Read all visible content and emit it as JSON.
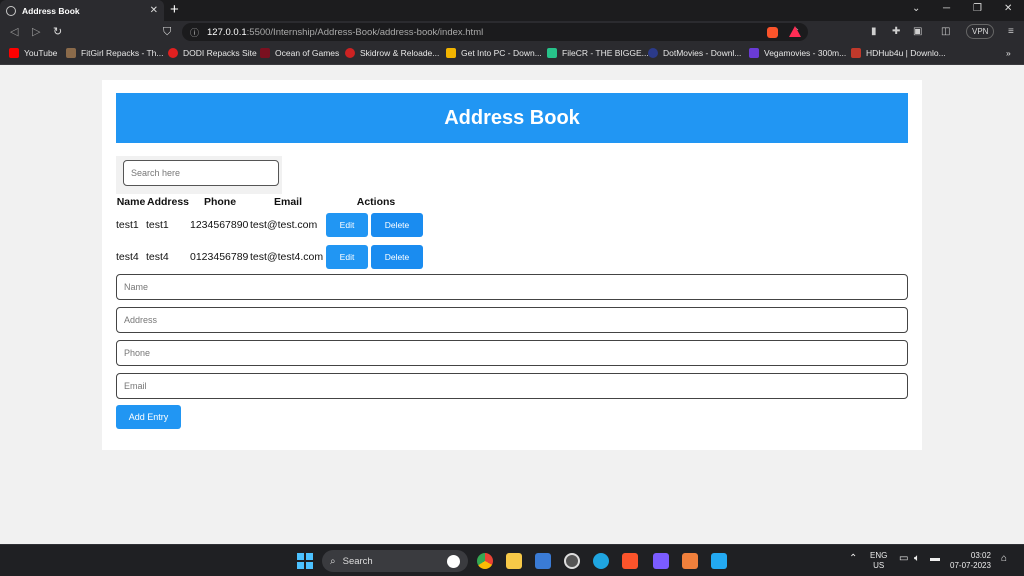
{
  "browser": {
    "tab_title": "Address Book",
    "tab_close": "✕",
    "new_tab": "+",
    "url_host": "127.0.0.1",
    "url_path": ":5500/Internship/Address-Book/address-book/index.html",
    "vpn_label": "VPN",
    "bookmarks": [
      {
        "label": "YouTube",
        "color": "#ff0000"
      },
      {
        "label": "FitGirl Repacks - Th...",
        "color": "#8a6a4a"
      },
      {
        "label": "DODI Repacks Site",
        "color": "#e02020"
      },
      {
        "label": "Ocean of Games",
        "color": "#7a1020"
      },
      {
        "label": "Skidrow & Reloade...",
        "color": "#cc2222"
      },
      {
        "label": "Get Into PC - Down...",
        "color": "#f2b400"
      },
      {
        "label": "FileCR - THE BIGGE...",
        "color": "#27c28a"
      },
      {
        "label": "DotMovies - Downl...",
        "color": "#2b3a8a"
      },
      {
        "label": "Vegamovies - 300m...",
        "color": "#6a3bd6"
      },
      {
        "label": "HDHub4u | Downlo...",
        "color": "#c0392b"
      }
    ],
    "bookmarks_more": "»"
  },
  "page": {
    "title": "Address Book",
    "search_placeholder": "Search here",
    "columns": [
      "Name",
      "Address",
      "Phone",
      "Email",
      "Actions"
    ],
    "entries": [
      {
        "name": "test1",
        "address": "test1",
        "phone": "1234567890",
        "email": "test@test.com"
      },
      {
        "name": "test4",
        "address": "test4",
        "phone": "0123456789",
        "email": "test@test4.com"
      }
    ],
    "edit_label": "Edit",
    "delete_label": "Delete",
    "form": {
      "name_placeholder": "Name",
      "address_placeholder": "Address",
      "phone_placeholder": "Phone",
      "email_placeholder": "Email"
    },
    "add_label": "Add Entry",
    "colors": {
      "accent": "#2196f3"
    }
  },
  "taskbar": {
    "search_label": "Search",
    "lang_top": "ENG",
    "lang_bottom": "US",
    "time": "03:02",
    "date": "07-07-2023"
  }
}
